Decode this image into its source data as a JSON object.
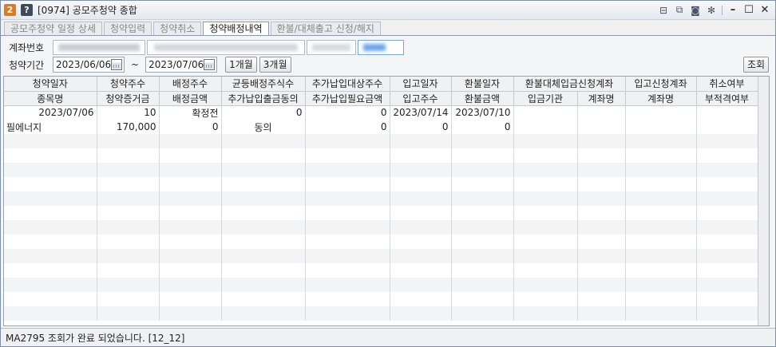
{
  "window": {
    "badge_num": "2",
    "badge_help": "?",
    "title": "[0974] 공모주청약 종합",
    "colors": {
      "badge_num": "#e07a1f",
      "badge_help": "#3c4a5c"
    }
  },
  "tabs": [
    {
      "label": "공모주청약 일정 상세",
      "active": false
    },
    {
      "label": "청약입력",
      "active": false
    },
    {
      "label": "청약취소",
      "active": false
    },
    {
      "label": "청약배정내역",
      "active": true
    },
    {
      "label": "환불/대체출고 신청/해지",
      "active": false
    }
  ],
  "form": {
    "account_label": "계좌번호",
    "period_label": "청약기간",
    "date_from": "2023/06/06",
    "tilde": "~",
    "date_to": "2023/07/06",
    "btn_1m": "1개월",
    "btn_3m": "3개월",
    "btn_search": "조회"
  },
  "grid": {
    "header1": [
      "청약일자",
      "청약주수",
      "배정주수",
      "균등배정주식수",
      "추가납입대상주수",
      "입고일자",
      "환불일자",
      "환불대체입금신청계좌",
      "",
      "입고신청계좌",
      "취소여부"
    ],
    "header2": [
      "종목명",
      "청약증거금",
      "배정금액",
      "추가납입출금동의",
      "추가납입필요금액",
      "입고주수",
      "환불금액",
      "입금기관",
      "계좌명",
      "계좌명",
      "부적격여부"
    ],
    "rows": [
      [
        "2023/07/06",
        "10",
        "확정전",
        "0",
        "0",
        "2023/07/14",
        "2023/07/10",
        "",
        "",
        "",
        ""
      ],
      [
        "필에너지",
        "170,000",
        "0",
        "동의",
        "0",
        "0",
        "0",
        "",
        "",
        "",
        ""
      ]
    ]
  },
  "status": {
    "message": "MA2795 조회가 완료 되었습니다. [12_12]"
  }
}
